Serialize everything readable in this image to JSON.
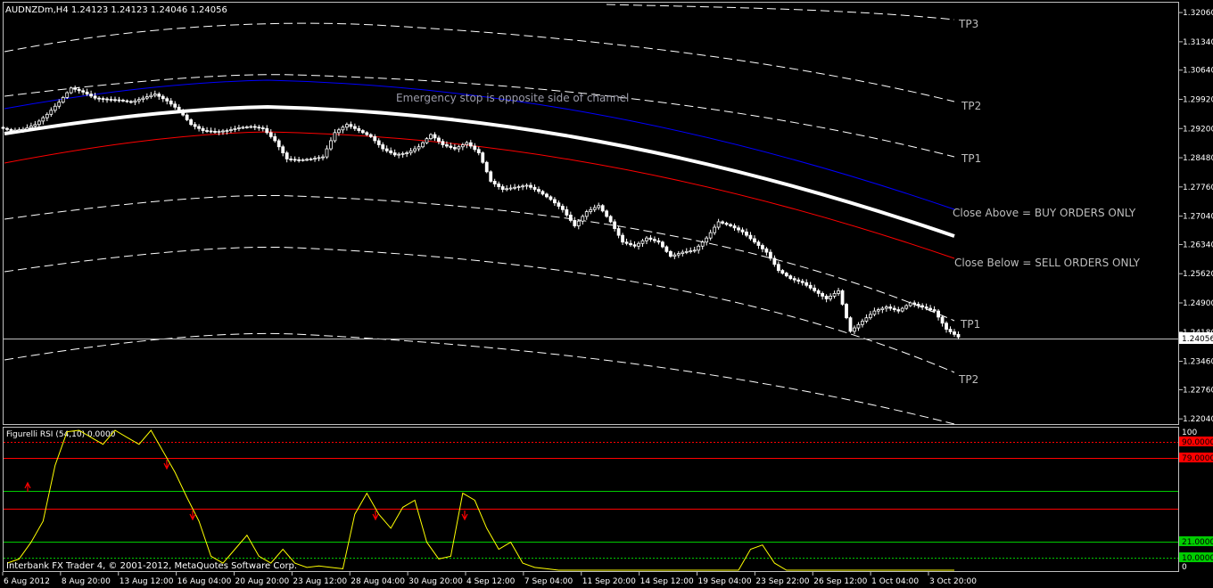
{
  "header": {
    "text": "AUDNZDm,H4  1.24123 1.24123 1.24046 1.24056"
  },
  "annotations": {
    "emergency_stop": "Emergency stop is opposite side of channel",
    "close_above": "Close Above = BUY ORDERS ONLY",
    "close_below": "Close Below = SELL ORDERS ONLY",
    "tp3": "TP3",
    "tp2_upper": "TP2",
    "tp1_upper": "TP1",
    "tp1_lower": "TP1",
    "tp2_lower": "TP2"
  },
  "indicator": {
    "label": "Figurelli RSI (54,10) 0.0000",
    "scale_top": "100",
    "scale_bottom": "0",
    "levels": [
      {
        "value": "90.0000",
        "color": "#ff0000"
      },
      {
        "value": "79.0000",
        "color": "#ff0000"
      },
      {
        "value": "21.0000",
        "color": "#00cc00"
      },
      {
        "value": "10.0000",
        "color": "#00cc00"
      }
    ]
  },
  "footer": {
    "copyright": "Interbank FX Trader 4, © 2001-2012, MetaQuotes Software Corp."
  },
  "price_axis": [
    "1.32060",
    "1.31340",
    "1.30640",
    "1.29920",
    "1.29200",
    "1.28480",
    "1.27760",
    "1.27040",
    "1.26340",
    "1.25620",
    "1.24900",
    "1.24180",
    "1.23460",
    "1.22760",
    "1.22040"
  ],
  "current_price": "1.24056",
  "time_axis": [
    "6 Aug 2012",
    "8 Aug 20:00",
    "13 Aug 12:00",
    "16 Aug 04:00",
    "20 Aug 20:00",
    "23 Aug 12:00",
    "28 Aug 04:00",
    "30 Aug 20:00",
    "4 Sep 12:00",
    "7 Sep 04:00",
    "11 Sep 20:00",
    "14 Sep 12:00",
    "19 Sep 04:00",
    "23 Sep 22:00",
    "26 Sep 12:00",
    "1 Oct 04:00",
    "3 Oct 20:00"
  ],
  "colors": {
    "candles": "#ffffff",
    "upper_band": "#0000ff",
    "lower_band": "#ff0000",
    "mid_line": "#ffffff",
    "rsi_line": "#ffff00",
    "arrows": "#ff0000"
  },
  "chart_data": {
    "type": "candlestick",
    "symbol": "AUDNZDm",
    "timeframe": "H4",
    "ohlc_last": [
      1.24123,
      1.24123,
      1.24046,
      1.24056
    ],
    "closes": [
      1.2915,
      1.2918,
      1.293,
      1.2955,
      1.2985,
      1.302,
      1.301,
      1.2995,
      1.2992,
      1.299,
      1.2985,
      1.2995,
      1.3005,
      1.2988,
      1.2965,
      1.293,
      1.2915,
      1.2912,
      1.2915,
      1.2922,
      1.2925,
      1.292,
      1.289,
      1.2845,
      1.2842,
      1.2845,
      1.285,
      1.291,
      1.293,
      1.2915,
      1.29,
      1.287,
      1.2855,
      1.286,
      1.2875,
      1.2905,
      1.288,
      1.287,
      1.2885,
      1.286,
      1.279,
      1.277,
      1.2775,
      1.278,
      1.2765,
      1.2745,
      1.272,
      1.268,
      1.2715,
      1.273,
      1.269,
      1.264,
      1.263,
      1.265,
      1.264,
      1.2605,
      1.2615,
      1.262,
      1.265,
      1.269,
      1.268,
      1.2665,
      1.264,
      1.2615,
      1.257,
      1.255,
      1.254,
      1.252,
      1.25,
      1.252,
      1.242,
      1.2445,
      1.247,
      1.248,
      1.247,
      1.249,
      1.248,
      1.247,
      1.2425,
      1.2406
    ],
    "rsi": [
      5,
      8,
      20,
      35,
      75,
      99,
      100,
      95,
      90,
      100,
      95,
      90,
      100,
      85,
      70,
      52,
      35,
      10,
      5,
      15,
      25,
      10,
      5,
      15,
      5,
      2,
      3,
      2,
      1,
      40,
      55,
      40,
      30,
      45,
      50,
      20,
      8,
      10,
      55,
      50,
      30,
      15,
      20,
      5,
      2,
      1,
      0,
      0,
      0,
      0,
      0,
      0,
      0,
      0,
      0,
      0,
      0,
      0,
      0,
      0,
      0,
      0,
      15,
      18,
      5,
      0,
      0,
      0,
      0,
      0,
      0,
      0,
      0,
      0,
      0,
      0,
      0,
      0,
      0,
      0
    ],
    "price_axis_range": [
      1.22,
      1.3215
    ],
    "rsi_axis_range": [
      0,
      100
    ],
    "rsi_levels": [
      90,
      79,
      21,
      10
    ]
  }
}
